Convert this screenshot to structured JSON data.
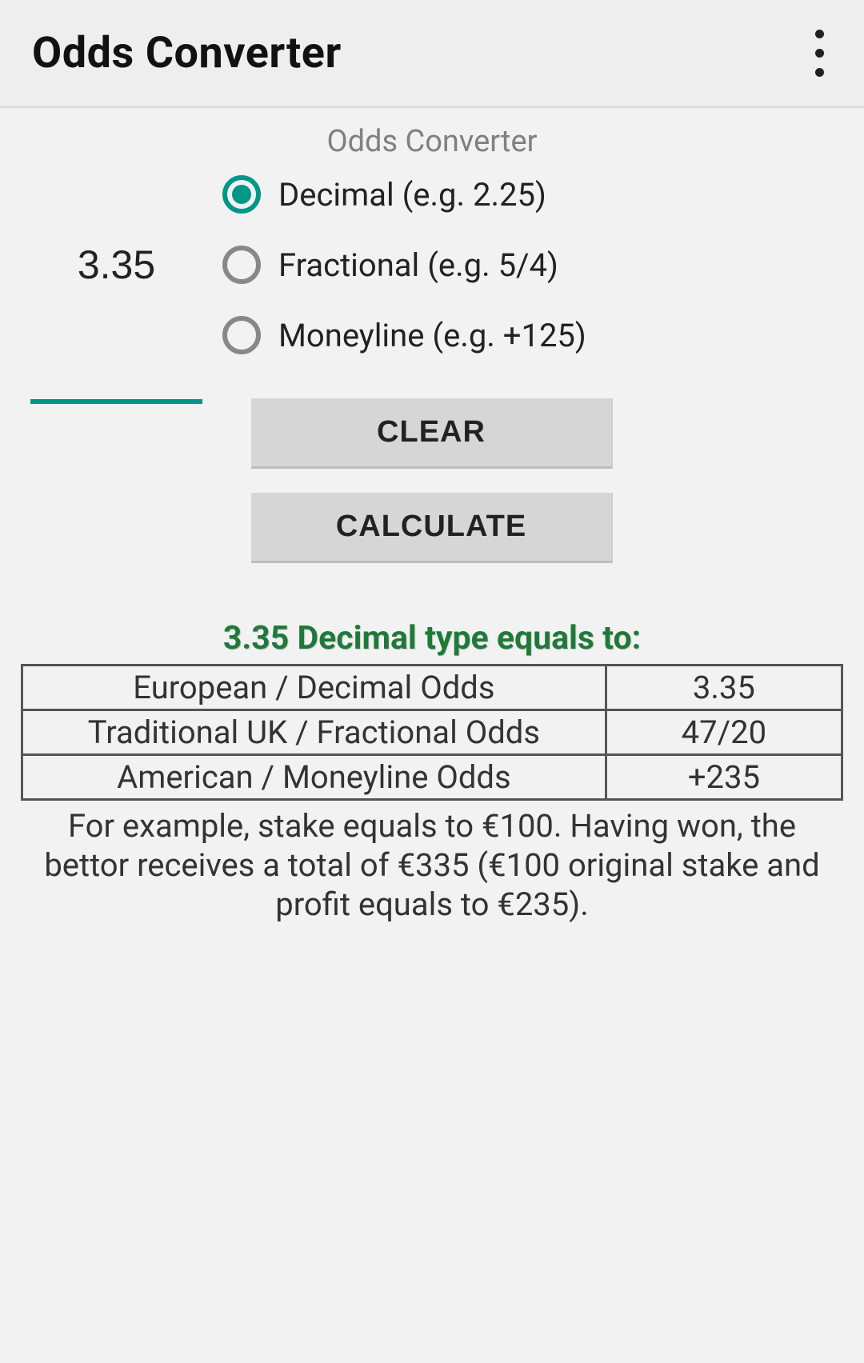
{
  "appbar": {
    "title": "Odds Converter"
  },
  "subtitle": "Odds Converter",
  "input": {
    "value": "3.35"
  },
  "radios": [
    {
      "label": "Decimal (e.g. 2.25)",
      "selected": true
    },
    {
      "label": "Fractional (e.g. 5/4)",
      "selected": false
    },
    {
      "label": "Moneyline (e.g. +125)",
      "selected": false
    }
  ],
  "buttons": {
    "clear": "CLEAR",
    "calculate": "CALCULATE"
  },
  "result": {
    "heading_value": "3.35",
    "heading_rest": " Decimal type equals to:",
    "rows": [
      {
        "label": "European / Decimal Odds",
        "value": "3.35"
      },
      {
        "label": "Traditional UK / Fractional Odds",
        "value": "47/20"
      },
      {
        "label": "American / Moneyline Odds",
        "value": "+235"
      }
    ],
    "example": "For example, stake equals to €100. Having won, the bettor receives a total of €335 (€100 original stake and profit equals to €235)."
  }
}
